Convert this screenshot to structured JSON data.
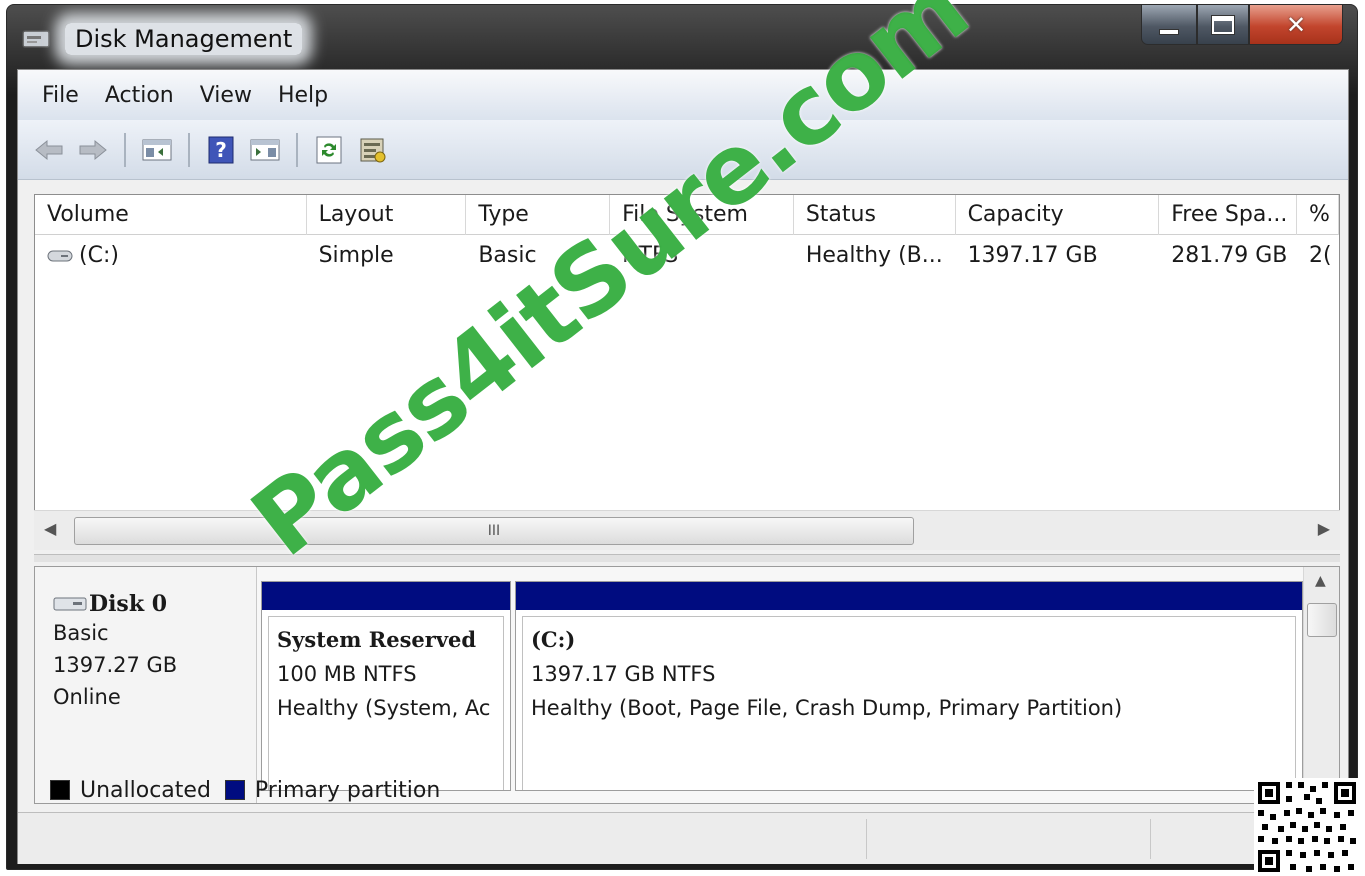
{
  "window": {
    "title": "Disk Management"
  },
  "menu": {
    "items": [
      "File",
      "Action",
      "View",
      "Help"
    ]
  },
  "toolbar": {
    "buttons": [
      "back-icon",
      "forward-icon",
      "show-hide-console-tree-icon",
      "help-icon",
      "show-hide-action-pane-icon",
      "refresh-icon",
      "properties-icon"
    ]
  },
  "volume_list": {
    "columns": [
      "Volume",
      "Layout",
      "Type",
      "File System",
      "Status",
      "Capacity",
      "Free Spa...",
      "%"
    ],
    "rows": [
      {
        "volume": "(C:)",
        "layout": "Simple",
        "type": "Basic",
        "file_system": "NTFS",
        "status": "Healthy (B...",
        "capacity": "1397.17 GB",
        "free_space": "281.79 GB",
        "percent": "2("
      }
    ],
    "scroll_grip": "III"
  },
  "disk": {
    "name": "Disk 0",
    "type": "Basic",
    "size": "1397.27 GB",
    "state": "Online",
    "partitions": [
      {
        "name": "System Reserved",
        "size_fs": "100 MB NTFS",
        "status": "Healthy (System, Ac"
      },
      {
        "name": "(C:)",
        "size_fs": "1397.17 GB NTFS",
        "status": "Healthy (Boot, Page File, Crash Dump, Primary Partition)"
      }
    ]
  },
  "legend": [
    {
      "label": "Unallocated",
      "color": "#000000"
    },
    {
      "label": "Primary partition",
      "color": "#000c80"
    }
  ],
  "watermark": "Pass4itSure.com",
  "colors": {
    "partition_bar": "#000c80",
    "watermark": "#2eaa38",
    "close_button": "#c2452d"
  }
}
